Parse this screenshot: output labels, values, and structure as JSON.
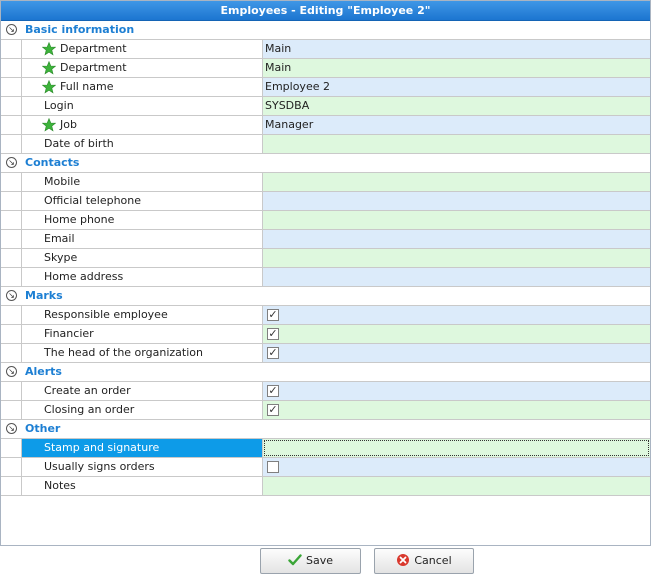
{
  "window": {
    "title": "Employees - Editing \"Employee 2\""
  },
  "sections": [
    {
      "title": "Basic information",
      "rows": [
        {
          "label": "Department",
          "value": "Main",
          "required": true,
          "type": "text",
          "tint": "blue"
        },
        {
          "label": "Department",
          "value": "Main",
          "required": true,
          "type": "text",
          "tint": "green"
        },
        {
          "label": "Full name",
          "value": "Employee 2",
          "required": true,
          "type": "text",
          "tint": "blue"
        },
        {
          "label": "Login",
          "value": "SYSDBA",
          "required": false,
          "type": "text",
          "tint": "green"
        },
        {
          "label": "Job",
          "value": "Manager",
          "required": true,
          "type": "text",
          "tint": "blue"
        },
        {
          "label": "Date of birth",
          "value": "",
          "required": false,
          "type": "text",
          "tint": "green"
        }
      ]
    },
    {
      "title": "Contacts",
      "rows": [
        {
          "label": "Mobile",
          "value": "",
          "type": "text",
          "tint": "green"
        },
        {
          "label": "Official telephone",
          "value": "",
          "type": "text",
          "tint": "blue"
        },
        {
          "label": "Home phone",
          "value": "",
          "type": "text",
          "tint": "green"
        },
        {
          "label": "Email",
          "value": "",
          "type": "text",
          "tint": "blue"
        },
        {
          "label": "Skype",
          "value": "",
          "type": "text",
          "tint": "green"
        },
        {
          "label": "Home address",
          "value": "",
          "type": "text",
          "tint": "blue"
        }
      ]
    },
    {
      "title": "Marks",
      "rows": [
        {
          "label": "Responsible employee",
          "checked": true,
          "type": "check",
          "tint": "blue"
        },
        {
          "label": "Financier",
          "checked": true,
          "type": "check",
          "tint": "green"
        },
        {
          "label": "The head of the organization",
          "checked": true,
          "type": "check",
          "tint": "blue"
        }
      ]
    },
    {
      "title": "Alerts",
      "rows": [
        {
          "label": "Create an order",
          "checked": true,
          "type": "check",
          "tint": "blue"
        },
        {
          "label": "Closing an order",
          "checked": true,
          "type": "check",
          "tint": "green"
        }
      ]
    },
    {
      "title": "Other",
      "rows": [
        {
          "label": "Stamp and signature",
          "value": "",
          "type": "text",
          "tint": "green",
          "selected": true
        },
        {
          "label": "Usually signs orders",
          "checked": false,
          "type": "check",
          "tint": "blue"
        },
        {
          "label": "Notes",
          "value": "",
          "type": "text",
          "tint": "green"
        }
      ]
    }
  ],
  "icons": {
    "collapse": "collapse-arrow-icon",
    "required": "green-star-icon",
    "check": "checkmark-icon",
    "save": "green-check-icon",
    "cancel": "red-cancel-icon"
  },
  "buttons": {
    "save": "Save",
    "cancel": "Cancel"
  },
  "colors": {
    "title_bar": "#1c75d0",
    "section_title": "#1d7fd3",
    "row_blue": "#dcebfa",
    "row_green": "#def8de",
    "selection": "#0d9be8"
  }
}
